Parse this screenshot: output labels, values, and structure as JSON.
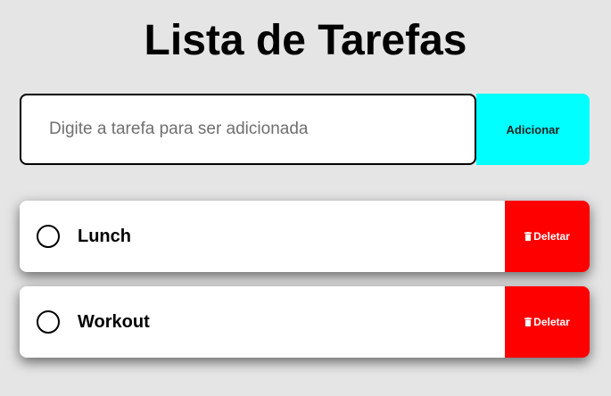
{
  "header": {
    "title": "Lista de Tarefas"
  },
  "form": {
    "input_value": "",
    "input_placeholder": "Digite a tarefa para ser adicionada",
    "add_label": "Adicionar"
  },
  "tasks": [
    {
      "label": "Lunch",
      "delete_label": "Deletar",
      "done": false
    },
    {
      "label": "Workout",
      "delete_label": "Deletar",
      "done": false
    }
  ],
  "colors": {
    "background": "#e5e5e5",
    "add_button": "#00ffff",
    "delete_button": "#ff0000"
  },
  "icons": {
    "delete": "trash-icon",
    "check": "circle-check-icon"
  }
}
